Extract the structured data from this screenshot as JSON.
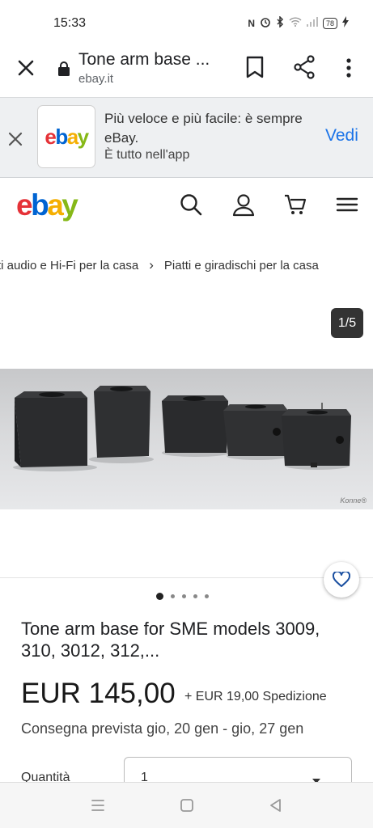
{
  "status_bar": {
    "time": "15:33",
    "battery": "78"
  },
  "browser": {
    "page_title": "Tone arm base ...",
    "domain": "ebay.it"
  },
  "app_banner": {
    "message": "Più veloce e più facile: è sempre eBay.",
    "sub": "È tutto nell'app",
    "open_label": "Vedi"
  },
  "header": {
    "logo": [
      "e",
      "b",
      "a",
      "y"
    ],
    "icons": [
      "search-icon",
      "user-icon",
      "cart-icon",
      "menu-icon"
    ]
  },
  "breadcrumb": [
    "ti audio e Hi-Fi per la casa",
    "Piatti e giradischi per la casa"
  ],
  "gallery": {
    "counter": "1/5",
    "image_count": 5,
    "active_index": 0,
    "watermark": "Konne®"
  },
  "product": {
    "title": "Tone arm base for SME models 3009, 310, 3012, 312,...",
    "price": "EUR 145,00",
    "shipping": "+ EUR 19,00 Spedizione",
    "delivery": "Consegna prevista gio, 20 gen - gio, 27 gen",
    "quantity_label": "Quantità",
    "quantity_value": "1"
  },
  "colors": {
    "link_blue": "#1a73e8",
    "ebay_red": "#e53238",
    "ebay_blue": "#0064d2",
    "ebay_yellow": "#f5af02",
    "ebay_green": "#86b817"
  }
}
